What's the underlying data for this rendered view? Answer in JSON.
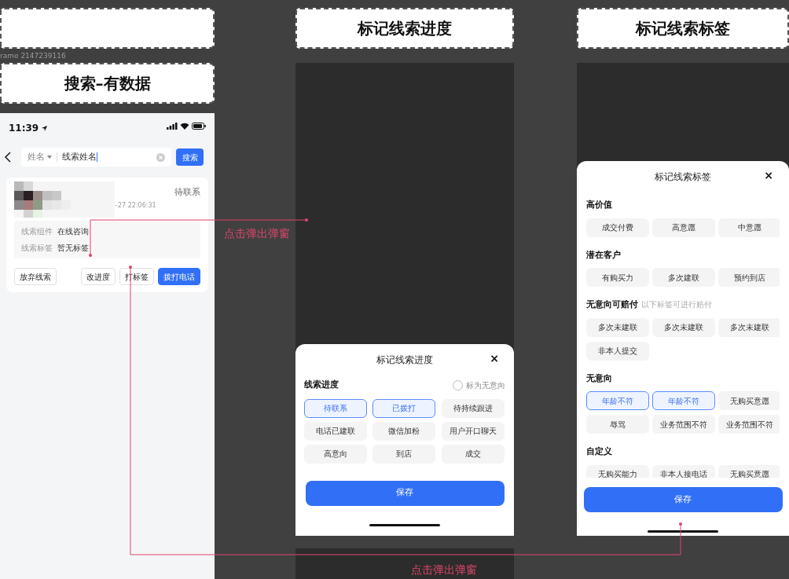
{
  "search_frame": {
    "frame_label": "rame 2147239116",
    "heading": "搜索–有数据",
    "status_bar": {
      "time": "11:39"
    },
    "search": {
      "filter": "姓名",
      "value": "线索姓名",
      "button": "搜索"
    },
    "lead_card": {
      "time": "–27 22:06:31",
      "status": "待联系",
      "fields": [
        {
          "label": "线索组件",
          "value": "在线咨询"
        },
        {
          "label": "线索标签",
          "value": "暂无标签"
        }
      ],
      "actions": [
        {
          "label": "放弃线索",
          "primary": false
        },
        {
          "label": "改进度",
          "primary": false
        },
        {
          "label": "打标签",
          "primary": false
        },
        {
          "label": "拨打电话",
          "primary": true
        }
      ]
    }
  },
  "progress_frame": {
    "heading": "标记线索进度",
    "sheet": {
      "title": "标记线索进度",
      "close": "×",
      "section_title": "线索进度",
      "option": {
        "label": "标为无意向",
        "checked": false
      },
      "chips": [
        {
          "label": "待联系",
          "selected": true
        },
        {
          "label": "已拨打",
          "selected": true
        },
        {
          "label": "待持续跟进",
          "selected": false
        },
        {
          "label": "电话已建联",
          "selected": false
        },
        {
          "label": "微信加粉",
          "selected": false
        },
        {
          "label": "用户开口聊天",
          "selected": false
        },
        {
          "label": "高意向",
          "selected": false
        },
        {
          "label": "到店",
          "selected": false
        },
        {
          "label": "成交",
          "selected": false
        }
      ],
      "save": "保存"
    }
  },
  "tags_frame": {
    "heading": "标记线索标签",
    "sheet": {
      "title": "标记线索标签",
      "close": "×",
      "groups": [
        {
          "title": "高价值",
          "chips": [
            {
              "label": "成交付费",
              "selected": false
            },
            {
              "label": "高意愿",
              "selected": false
            },
            {
              "label": "中意愿",
              "selected": false
            }
          ]
        },
        {
          "title": "潜在客户",
          "chips": [
            {
              "label": "有购买力",
              "selected": false
            },
            {
              "label": "多次建联",
              "selected": false
            },
            {
              "label": "预约到店",
              "selected": false
            }
          ]
        },
        {
          "title": "无意向可赔付",
          "note": "以下标签可进行赔付",
          "chips": [
            {
              "label": "多次未建联",
              "selected": false
            },
            {
              "label": "多次未建联",
              "selected": false
            },
            {
              "label": "多次未建联",
              "selected": false
            },
            {
              "label": "非本人提交",
              "selected": false
            }
          ]
        },
        {
          "title": "无意向",
          "chips": [
            {
              "label": "年龄不符",
              "selected": true
            },
            {
              "label": "年龄不符",
              "selected": true
            },
            {
              "label": "无购买意愿",
              "selected": false
            },
            {
              "label": "辱骂",
              "selected": false
            },
            {
              "label": "业务范围不符",
              "selected": false
            },
            {
              "label": "业务范围不符",
              "selected": false
            }
          ]
        },
        {
          "title": "自定义",
          "chips": [
            {
              "label": "无购买能力",
              "selected": false
            },
            {
              "label": "非本人接电话",
              "selected": false
            },
            {
              "label": "无购买意愿",
              "selected": false
            }
          ]
        }
      ],
      "save": "保存"
    }
  },
  "annotations": [
    {
      "text": "点击弹出弹窗"
    },
    {
      "text": "点击弹出弹窗"
    }
  ]
}
